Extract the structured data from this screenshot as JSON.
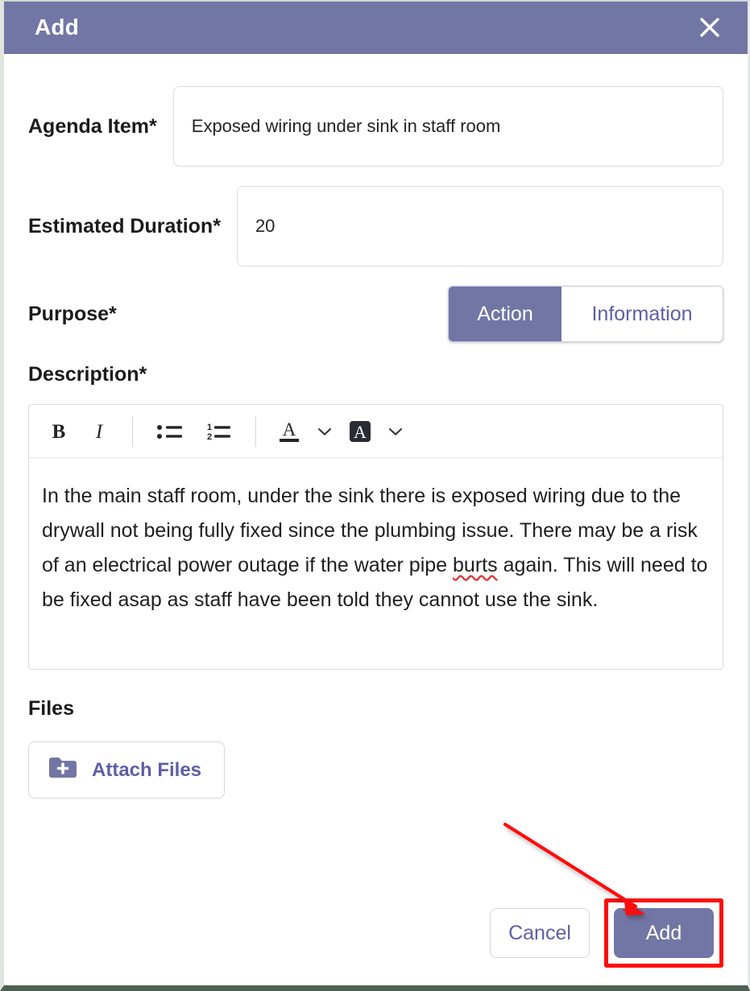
{
  "dialog": {
    "title": "Add",
    "close_icon": "close-icon"
  },
  "fields": {
    "agenda": {
      "label": "Agenda Item*",
      "value": "Exposed wiring under sink in staff room",
      "placeholder": ""
    },
    "duration": {
      "label": "Estimated Duration*",
      "value": "20",
      "placeholder": ""
    },
    "purpose": {
      "label": "Purpose*",
      "options": [
        "Action",
        "Information"
      ],
      "selected": "Action",
      "option_action": "Action",
      "option_information": "Information"
    },
    "description": {
      "label": "Description*",
      "toolbar": {
        "bold": "bold-icon",
        "italic": "italic-icon",
        "bullet_list": "bulleted-list-icon",
        "numbered_list": "numbered-list-icon",
        "font_color": "font-color-icon",
        "font_color_chevron": "chevron-down-icon",
        "highlight": "highlight-color-icon",
        "highlight_chevron": "chevron-down-icon"
      },
      "text_part_1": "In the main staff room, under the sink there is exposed wiring due to the drywall not being fully fixed since the plumbing issue. There may be a risk of an electrical power outage if the water pipe ",
      "misspelled_word": "burts",
      "text_part_2": " again. This will need to be fixed asap as staff have been told they cannot use the sink.",
      "full_text": "In the main staff room, under the sink there is exposed wiring due to the drywall not being fully fixed since the plumbing issue. There may be a risk of an electrical power outage if the water pipe burts again. This will need to be fixed asap as staff have been told they cannot use the sink."
    },
    "files": {
      "label": "Files",
      "attach_label": "Attach Files",
      "attach_icon": "folder-plus-icon"
    }
  },
  "footer": {
    "cancel_label": "Cancel",
    "add_label": "Add"
  },
  "colors": {
    "accent_purple": "#7276a5",
    "accent_text_purple": "#5e5fa6",
    "annotation_red": "#fd0d0d",
    "spellcheck_red": "#e23b3b",
    "frame_green": "#4c6152"
  }
}
